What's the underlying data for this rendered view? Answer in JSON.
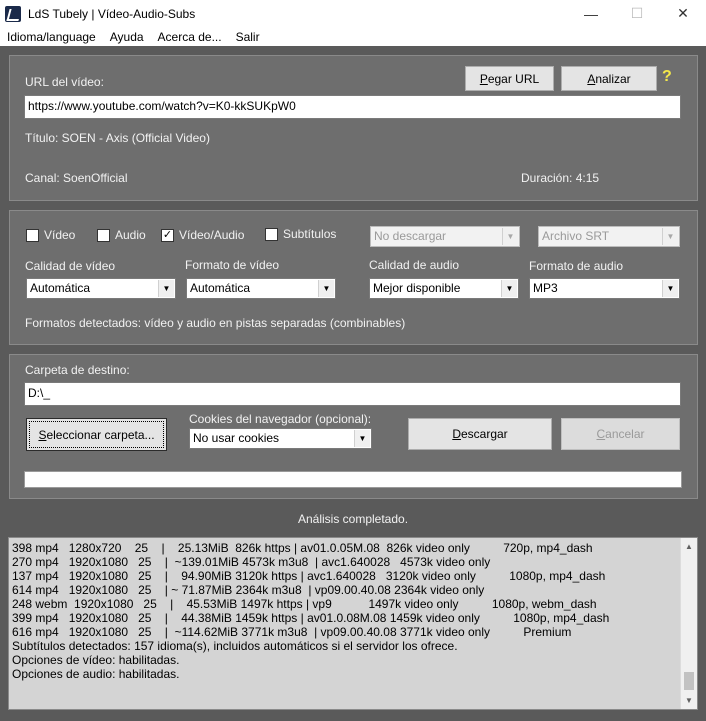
{
  "window": {
    "title": "LdS Tubely | Vídeo-Audio-Subs",
    "controls": {
      "minimize": "—",
      "maximize": "☐",
      "close": "✕"
    }
  },
  "menu": [
    "Idioma/language",
    "Ayuda",
    "Acerca de...",
    "Salir"
  ],
  "url_section": {
    "label": "URL del vídeo:",
    "url_value": "https://www.youtube.com/watch?v=K0-kkSUKpW0",
    "paste_button": {
      "u": "P",
      "rest": "egar URL"
    },
    "analyze_button": {
      "u": "A",
      "rest": "nalizar"
    },
    "help": "?",
    "title_text": "Título: SOEN - Axis (Official Video)",
    "channel_text": "Canal: SoenOfficial",
    "duration_text": "Duración: 4:15"
  },
  "options": {
    "checkboxes": [
      {
        "label": "Vídeo",
        "checked": false
      },
      {
        "label": "Audio",
        "checked": false
      },
      {
        "label": "Vídeo/Audio",
        "checked": true
      },
      {
        "label": "Subtítulos",
        "checked": false
      }
    ],
    "subs_select": "No descargar",
    "subs_format_select": "Archivo SRT",
    "video_quality_label": "Calidad de vídeo",
    "video_quality_value": "Automática",
    "video_format_label": "Formato de vídeo",
    "video_format_value": "Automática",
    "audio_quality_label": "Calidad de audio",
    "audio_quality_value": "Mejor disponible",
    "audio_format_label": "Formato de audio",
    "audio_format_value": "MP3",
    "formats_detected": "Formatos detectados: vídeo y audio en pistas separadas (combinables)"
  },
  "destination": {
    "label": "Carpeta de destino:",
    "path_value": "D:\\_",
    "select_folder_button": {
      "u": "S",
      "rest": "eleccionar carpeta..."
    },
    "cookies_label": "Cookies del navegador (opcional):",
    "cookies_value": "No usar cookies",
    "download_button": {
      "u": "D",
      "rest": "escargar"
    },
    "cancel_button": {
      "u": "C",
      "rest": "ancelar"
    },
    "progress_percent": 0
  },
  "status": "Análisis completado.",
  "log": [
    "398 mp4   1280x720    25    |    25.13MiB  826k https | av01.0.05M.08  826k video only          720p, mp4_dash",
    "270 mp4   1920x1080   25    |  ~139.01MiB 4573k m3u8  | avc1.640028   4573k video only",
    "137 mp4   1920x1080   25    |    94.90MiB 3120k https | avc1.640028   3120k video only          1080p, mp4_dash",
    "614 mp4   1920x1080   25    | ~ 71.87MiB 2364k m3u8  | vp09.00.40.08 2364k video only",
    "248 webm  1920x1080   25    |    45.53MiB 1497k https | vp9           1497k video only          1080p, webm_dash",
    "399 mp4   1920x1080   25    |    44.38MiB 1459k https | av01.0.08M.08 1459k video only          1080p, mp4_dash",
    "616 mp4   1920x1080   25    |  ~114.62MiB 3771k m3u8  | vp09.00.40.08 3771k video only          Premium",
    "Subtítulos detectados: 157 idioma(s), incluidos automáticos si el servidor los ofrece.",
    "Opciones de vídeo: habilitadas.",
    "Opciones de audio: habilitadas."
  ],
  "colors": {
    "background": "#5a5a5a",
    "panel": "#6e6e6e",
    "log_bg": "#d4d4d4",
    "help": "#f4e84a"
  }
}
